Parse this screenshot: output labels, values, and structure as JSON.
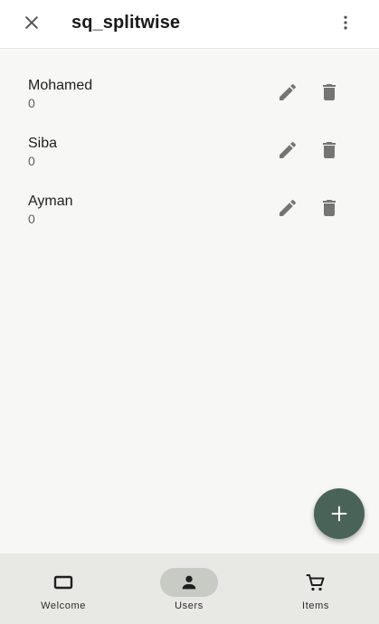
{
  "app_bar": {
    "title": "sq_splitwise",
    "close_icon": "close-icon",
    "menu_icon": "more-vert-icon"
  },
  "users": [
    {
      "name": "Mohamed",
      "balance": "0"
    },
    {
      "name": "Siba",
      "balance": "0"
    },
    {
      "name": "Ayman",
      "balance": "0"
    }
  ],
  "row_actions": {
    "edit_icon": "pencil-icon",
    "delete_icon": "trash-icon"
  },
  "fab": {
    "icon": "plus-icon",
    "color": "#4a6358"
  },
  "bottom_nav": {
    "items": [
      {
        "label": "Welcome",
        "icon": "welcome-icon",
        "active": false
      },
      {
        "label": "Users",
        "icon": "person-icon",
        "active": true
      },
      {
        "label": "Items",
        "icon": "cart-icon",
        "active": false
      }
    ],
    "active_indicator_color": "#c7cbc4"
  },
  "colors": {
    "background": "#f7f7f5",
    "icon": "#757575",
    "text": "#1f1f1f"
  }
}
